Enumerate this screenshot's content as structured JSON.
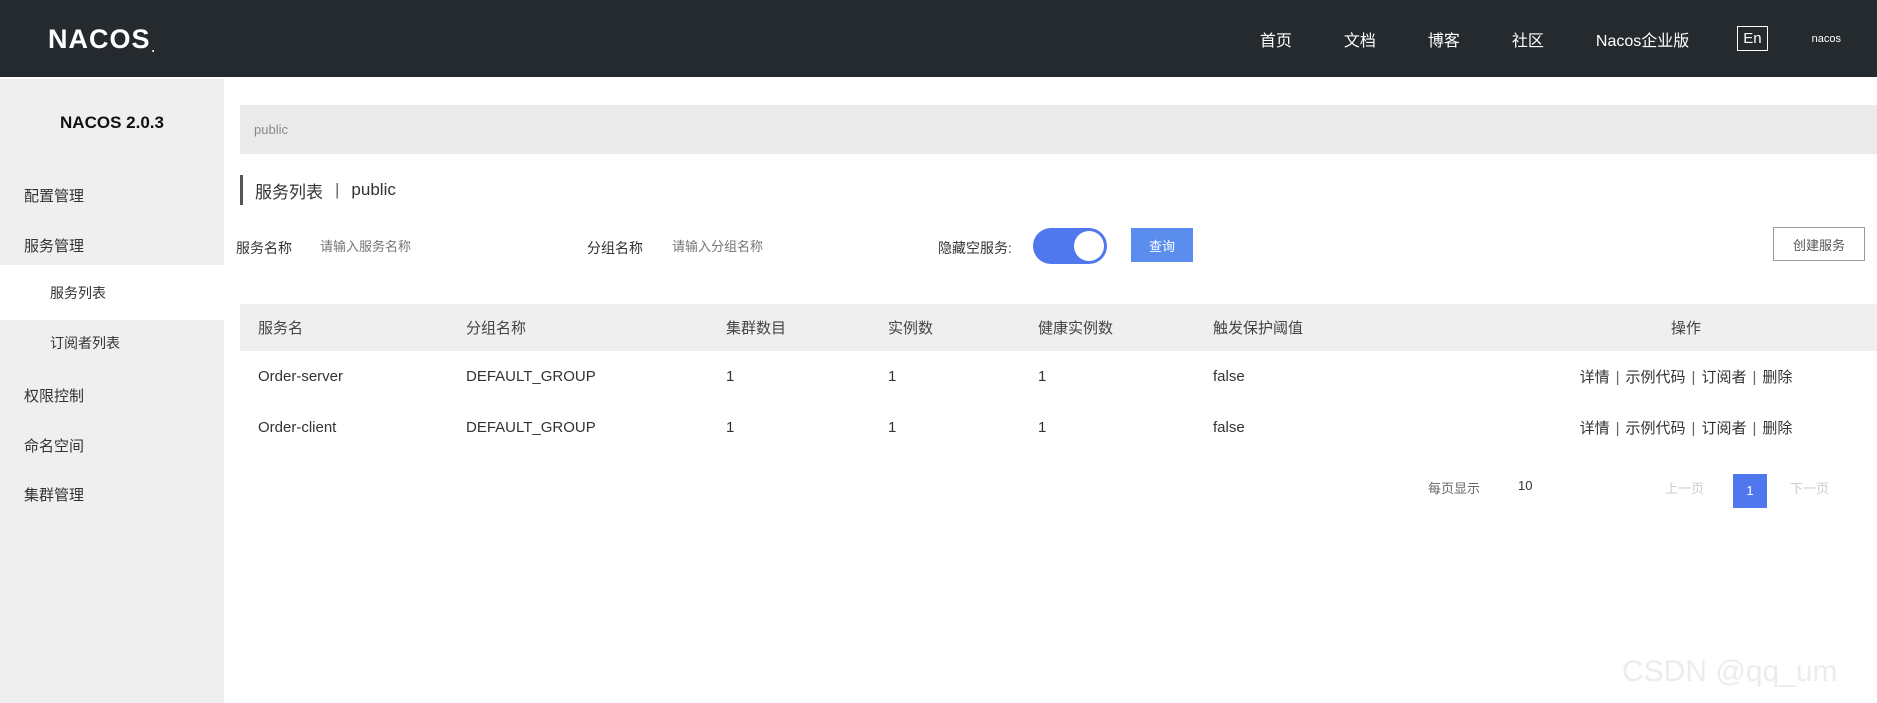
{
  "header": {
    "logo": "NACOS",
    "logo_dot": ".",
    "nav": [
      "首页",
      "文档",
      "博客",
      "社区",
      "Nacos企业版"
    ],
    "lang": "En",
    "user": "nacos"
  },
  "sidebar": {
    "version": "NACOS 2.0.3",
    "items": {
      "config": "配置管理",
      "service": "服务管理",
      "service_list": "服务列表",
      "subscribers": "订阅者列表",
      "access": "权限控制",
      "namespace": "命名空间",
      "cluster": "集群管理"
    }
  },
  "breadcrumb": "public",
  "page": {
    "title": "服务列表",
    "namespace": "public"
  },
  "filters": {
    "service_label": "服务名称",
    "service_placeholder": "请输入服务名称",
    "group_label": "分组名称",
    "group_placeholder": "请输入分组名称",
    "hide_empty_label": "隐藏空服务:",
    "hide_empty_on": true,
    "query_button": "查询",
    "create_button": "创建服务"
  },
  "table": {
    "headers": [
      "服务名",
      "分组名称",
      "集群数目",
      "实例数",
      "健康实例数",
      "触发保护阈值",
      "操作"
    ],
    "rows": [
      {
        "name": "Order-server",
        "group": "DEFAULT_GROUP",
        "clusters": "1",
        "instances": "1",
        "healthy": "1",
        "threshold": "false"
      },
      {
        "name": "Order-client",
        "group": "DEFAULT_GROUP",
        "clusters": "1",
        "instances": "1",
        "healthy": "1",
        "threshold": "false"
      }
    ],
    "ops": [
      "详情",
      "示例代码",
      "订阅者",
      "删除"
    ]
  },
  "pagination": {
    "per_page_label": "每页显示",
    "per_page_value": "10",
    "prev": "上一页",
    "current": "1",
    "next": "下一页"
  },
  "watermark": "CSDN @qq_um"
}
